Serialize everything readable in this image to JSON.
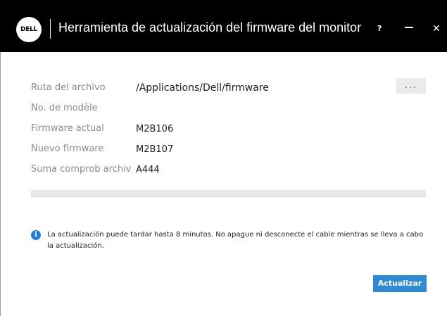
{
  "window": {
    "logo_text": "DELL",
    "title": "Herramienta de actualización del firmware del monitor",
    "help_label": "?",
    "close_label": "✕"
  },
  "fields": {
    "path_label": "Ruta del archivo",
    "path_value": "/Applications/Dell/firmware",
    "browse_label": "...",
    "model_label": "No. de modèle",
    "model_value": "",
    "current_label": "Firmware actual",
    "current_value": "M2B106",
    "new_label": "Nuevo firmware",
    "new_value": "M2B107",
    "checksum_label": "Suma comprob archiv",
    "checksum_value": "A444"
  },
  "progress": {
    "fraction": 0
  },
  "info": {
    "icon": "info-icon",
    "message": "La actualización puede tardar hasta 8 minutos. No apague ni desconecte el cable mientras se lleva a cabo la actualización."
  },
  "actions": {
    "update_label": "Actualizar"
  },
  "colors": {
    "titlebar": "#000000",
    "accent": "#2f8ad6",
    "label": "#8a8a8a"
  }
}
